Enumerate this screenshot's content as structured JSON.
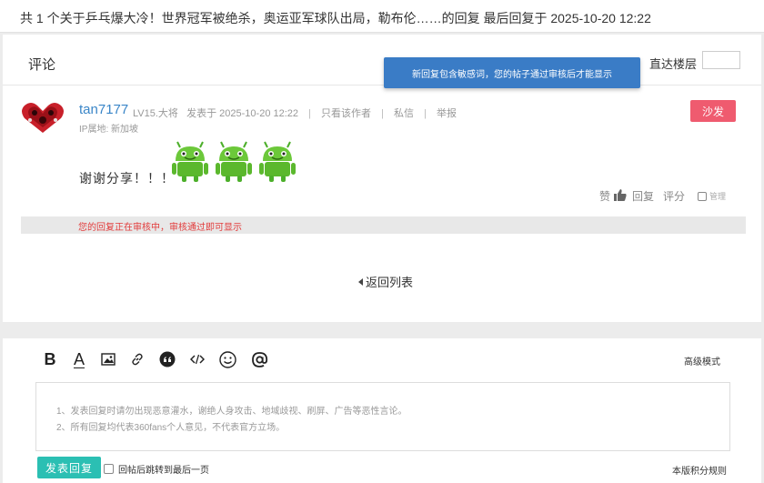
{
  "topbar": {
    "text": "共 1 个关于乒乓爆大冷！世界冠军被绝杀，奥运亚军球队出局，勒布伦……的回复 最后回复于 2025-10-20 12:22"
  },
  "comments": {
    "title": "评论",
    "jump_label": "直达楼层",
    "tooltip": "新回复包含敏感词，您的帖子通过审核后才能显示"
  },
  "post": {
    "username": "tan7177",
    "level": "LV15.大将",
    "posted_at": "发表于 2025-10-20 12:22",
    "only_author": "只看该作者",
    "private_msg": "私信",
    "report": "举报",
    "sep": "|",
    "ip": "IP属地: 新加坡",
    "sofa": "沙发",
    "text": "谢谢分享！！！",
    "like": "赞",
    "reply": "回复",
    "rate": "评分",
    "manage": "管理",
    "review_notice": "您的回复正在审核中，审核通过即可显示"
  },
  "back": {
    "label": "返回列表"
  },
  "editor": {
    "bold": "B",
    "font": "A",
    "advanced_mode": "高级模式",
    "guide_1": "1、发表回复时请勿出现恶意灌水，谢绝人身攻击、地域歧视、刷屏、广告等恶性言论。",
    "guide_2": "2、所有回复均代表360fans个人意见，不代表官方立场。",
    "submit": "发表回复",
    "jump_last": "回帖后跳转到最后一页",
    "rules": "本版积分规则"
  },
  "colors": {
    "link_blue": "#3a86c8",
    "tooltip_blue": "#3a7cc6",
    "sofa_red": "#ef5b6f",
    "submit_teal": "#2bbfb3",
    "review_red": "#e23a3a"
  }
}
